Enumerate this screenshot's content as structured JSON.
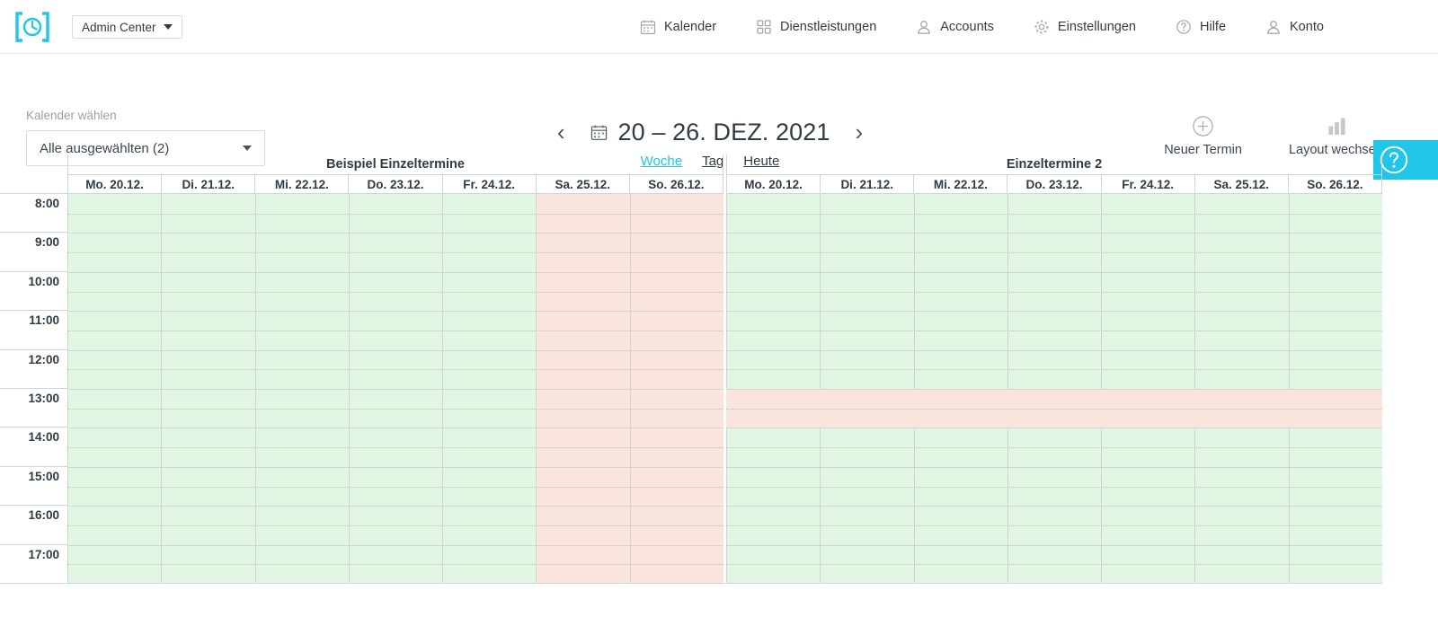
{
  "topbar": {
    "logo_icon": "clock-bracket-logo",
    "brand_label": "Admin Center",
    "nav": [
      {
        "label": "Kalender",
        "icon": "calendar-icon"
      },
      {
        "label": "Dienstleistungen",
        "icon": "grid-squares-icon"
      },
      {
        "label": "Accounts",
        "icon": "user-icon"
      },
      {
        "label": "Einstellungen",
        "icon": "gear-icon"
      },
      {
        "label": "Hilfe",
        "icon": "question-circle-icon"
      },
      {
        "label": "Konto",
        "icon": "user-icon"
      }
    ]
  },
  "calendar_select": {
    "label": "Kalender wählen",
    "value": "Alle ausgewählten (2)",
    "caret_icon": "caret-down-icon"
  },
  "datenav": {
    "prev_icon": "chevron-left-icon",
    "next_icon": "chevron-right-icon",
    "calendar_icon": "calendar-icon",
    "title": "20 – 26. DEZ. 2021",
    "tabs": [
      {
        "label": "Woche",
        "active": true
      },
      {
        "label": "Tag",
        "active": false
      },
      {
        "label": "Heute",
        "active": false
      }
    ],
    "active_color": "#1fc6ea"
  },
  "actions": [
    {
      "label": "Neuer Termin",
      "icon": "plus-circle-icon"
    },
    {
      "label": "Layout wechseln",
      "icon": "bar-chart-icon"
    }
  ],
  "help_button": {
    "icon": "question-circle-icon",
    "bg": "#1fc6ea"
  },
  "grid": {
    "time_labels": [
      "8:00",
      "9:00",
      "10:00",
      "11:00",
      "12:00",
      "13:00",
      "14:00",
      "15:00",
      "16:00",
      "17:00"
    ],
    "colors": {
      "available": "#e2f7e3",
      "closed": "#fae5dd",
      "line": "#cfd4d6",
      "half_line": "#b9c0c4"
    },
    "calendars": [
      {
        "title": "Beispiel Einzeltermine",
        "days": [
          {
            "label": "Mo. 20.12.",
            "state": "available"
          },
          {
            "label": "Di. 21.12.",
            "state": "available"
          },
          {
            "label": "Mi. 22.12.",
            "state": "available"
          },
          {
            "label": "Do. 23.12.",
            "state": "available"
          },
          {
            "label": "Fr. 24.12.",
            "state": "available"
          },
          {
            "label": "Sa. 25.12.",
            "state": "closed"
          },
          {
            "label": "So. 26.12.",
            "state": "closed"
          }
        ],
        "breaks": []
      },
      {
        "title": "Einzeltermine 2",
        "days": [
          {
            "label": "Mo. 20.12.",
            "state": "available"
          },
          {
            "label": "Di. 21.12.",
            "state": "available"
          },
          {
            "label": "Mi. 22.12.",
            "state": "available"
          },
          {
            "label": "Do. 23.12.",
            "state": "available"
          },
          {
            "label": "Fr. 24.12.",
            "state": "available"
          },
          {
            "label": "Sa. 25.12.",
            "state": "available"
          },
          {
            "label": "So. 26.12.",
            "state": "available"
          }
        ],
        "breaks": [
          {
            "from": "13:00",
            "to": "14:00"
          }
        ]
      }
    ]
  }
}
